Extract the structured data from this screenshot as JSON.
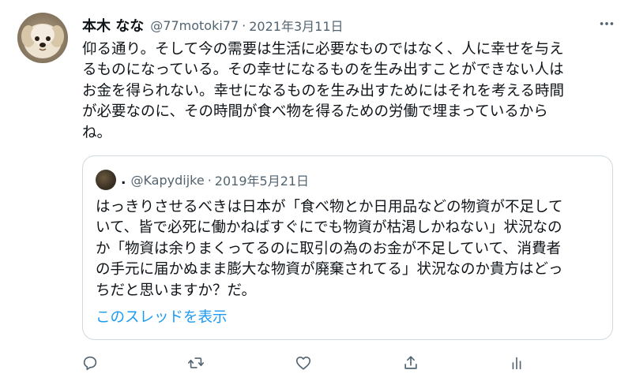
{
  "author": {
    "display_name": "本木 なな",
    "handle": "@77motoki77",
    "separator": "·",
    "date": "2021年3月11日"
  },
  "tweet": {
    "lines": [
      "仰る通り。そして今の需要は生活に必要なものではなく、人に幸せを与え",
      "るものになっている。その幸せになるものを生み出すことができない人は",
      "お金を得られない。幸せになるものを生み出すためにはそれを考える時間",
      "が必要なのに、その時間が食べ物を得るための労働で埋まっているから",
      "ね。"
    ]
  },
  "quote": {
    "display_name": ".",
    "handle": "@Kapydijke",
    "separator": "·",
    "date": "2019年5月21日",
    "lines": [
      "はっきりさせるべきは日本が「食べ物とか日用品などの物資が不足して",
      "いて、皆で必死に働かねばすぐにでも物資が枯渇しかねない」状況なの",
      "か「物資は余りまくってるのに取引の為のお金が不足していて、消費者",
      "の手元に届かぬまま膨大な物資が廃棄されてる」状況なのか貴方はどっ",
      "ちだと思いますか？だ。"
    ],
    "show_thread_label": "このスレッドを表示"
  },
  "actions": {
    "icons": [
      "reply-icon",
      "retweet-icon",
      "like-icon",
      "share-icon",
      "analytics-icon"
    ]
  },
  "colors": {
    "text_primary": "#0f1419",
    "text_secondary": "#536471",
    "link": "#1d9bf0",
    "border": "#cfd9de"
  }
}
